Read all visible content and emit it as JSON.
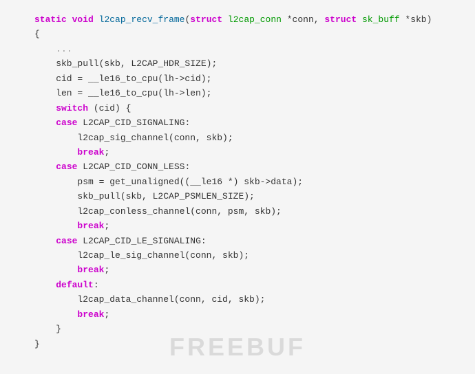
{
  "code": {
    "lines": [
      {
        "id": "l1",
        "tokens": [
          {
            "t": "kw",
            "v": "static"
          },
          {
            "t": "va",
            "v": " "
          },
          {
            "t": "kw",
            "v": "void"
          },
          {
            "t": "va",
            "v": " "
          },
          {
            "t": "fn",
            "v": "l2cap_recv_frame"
          },
          {
            "t": "va",
            "v": "("
          },
          {
            "t": "kw",
            "v": "struct"
          },
          {
            "t": "va",
            "v": " "
          },
          {
            "t": "ty",
            "v": "l2cap_conn"
          },
          {
            "t": "va",
            "v": " *conn, "
          },
          {
            "t": "kw",
            "v": "struct"
          },
          {
            "t": "va",
            "v": " "
          },
          {
            "t": "ty",
            "v": "sk_buff"
          },
          {
            "t": "va",
            "v": " *skb)"
          }
        ]
      },
      {
        "id": "l2",
        "tokens": [
          {
            "t": "va",
            "v": "{"
          }
        ]
      },
      {
        "id": "l3",
        "tokens": [
          {
            "t": "va",
            "v": "    "
          },
          {
            "t": "co",
            "v": "..."
          }
        ]
      },
      {
        "id": "l4",
        "tokens": [
          {
            "t": "va",
            "v": "    skb_pull(skb, L2CAP_HDR_SIZE);"
          }
        ]
      },
      {
        "id": "l5",
        "tokens": [
          {
            "t": "va",
            "v": "    cid = __le16_to_cpu(lh->cid);"
          }
        ]
      },
      {
        "id": "l6",
        "tokens": [
          {
            "t": "va",
            "v": "    len = __le16_to_cpu(lh->len);"
          }
        ]
      },
      {
        "id": "l7",
        "tokens": [
          {
            "t": "va",
            "v": ""
          }
        ]
      },
      {
        "id": "l8",
        "tokens": [
          {
            "t": "va",
            "v": "    "
          },
          {
            "t": "kw",
            "v": "switch"
          },
          {
            "t": "va",
            "v": " (cid) {"
          }
        ]
      },
      {
        "id": "l9",
        "tokens": [
          {
            "t": "va",
            "v": "    "
          },
          {
            "t": "kw",
            "v": "case"
          },
          {
            "t": "va",
            "v": " L2CAP_CID_SIGNALING:"
          }
        ]
      },
      {
        "id": "l10",
        "tokens": [
          {
            "t": "va",
            "v": "        l2cap_sig_channel(conn, skb);"
          }
        ]
      },
      {
        "id": "l11",
        "tokens": [
          {
            "t": "va",
            "v": "        "
          },
          {
            "t": "kw",
            "v": "break"
          },
          {
            "t": "va",
            "v": ";"
          }
        ]
      },
      {
        "id": "l12",
        "tokens": [
          {
            "t": "va",
            "v": ""
          }
        ]
      },
      {
        "id": "l13",
        "tokens": [
          {
            "t": "va",
            "v": "    "
          },
          {
            "t": "kw",
            "v": "case"
          },
          {
            "t": "va",
            "v": " L2CAP_CID_CONN_LESS:"
          }
        ]
      },
      {
        "id": "l14",
        "tokens": [
          {
            "t": "va",
            "v": "        psm = get_unaligned((__le16 *) skb->data);"
          }
        ]
      },
      {
        "id": "l15",
        "tokens": [
          {
            "t": "va",
            "v": "        skb_pull(skb, L2CAP_PSMLEN_SIZE);"
          }
        ]
      },
      {
        "id": "l16",
        "tokens": [
          {
            "t": "va",
            "v": "        l2cap_conless_channel(conn, psm, skb);"
          }
        ]
      },
      {
        "id": "l17",
        "tokens": [
          {
            "t": "va",
            "v": "        "
          },
          {
            "t": "kw",
            "v": "break"
          },
          {
            "t": "va",
            "v": ";"
          }
        ]
      },
      {
        "id": "l18",
        "tokens": [
          {
            "t": "va",
            "v": ""
          }
        ]
      },
      {
        "id": "l19",
        "tokens": [
          {
            "t": "va",
            "v": "    "
          },
          {
            "t": "kw",
            "v": "case"
          },
          {
            "t": "va",
            "v": " L2CAP_CID_LE_SIGNALING:"
          }
        ]
      },
      {
        "id": "l20",
        "tokens": [
          {
            "t": "va",
            "v": "        l2cap_le_sig_channel(conn, skb);"
          }
        ]
      },
      {
        "id": "l21",
        "tokens": [
          {
            "t": "va",
            "v": "        "
          },
          {
            "t": "kw",
            "v": "break"
          },
          {
            "t": "va",
            "v": ";"
          }
        ]
      },
      {
        "id": "l22",
        "tokens": [
          {
            "t": "va",
            "v": ""
          }
        ]
      },
      {
        "id": "l23",
        "tokens": [
          {
            "t": "va",
            "v": "    "
          },
          {
            "t": "kw",
            "v": "default"
          },
          {
            "t": "va",
            "v": ":"
          }
        ]
      },
      {
        "id": "l24",
        "tokens": [
          {
            "t": "va",
            "v": "        l2cap_data_channel(conn, cid, skb);"
          }
        ]
      },
      {
        "id": "l25",
        "tokens": [
          {
            "t": "va",
            "v": "        "
          },
          {
            "t": "kw",
            "v": "break"
          },
          {
            "t": "va",
            "v": ";"
          }
        ]
      },
      {
        "id": "l26",
        "tokens": [
          {
            "t": "va",
            "v": "    }"
          }
        ]
      },
      {
        "id": "l27",
        "tokens": [
          {
            "t": "va",
            "v": "}"
          }
        ]
      }
    ]
  },
  "watermark": {
    "text": "FREEBUF"
  }
}
